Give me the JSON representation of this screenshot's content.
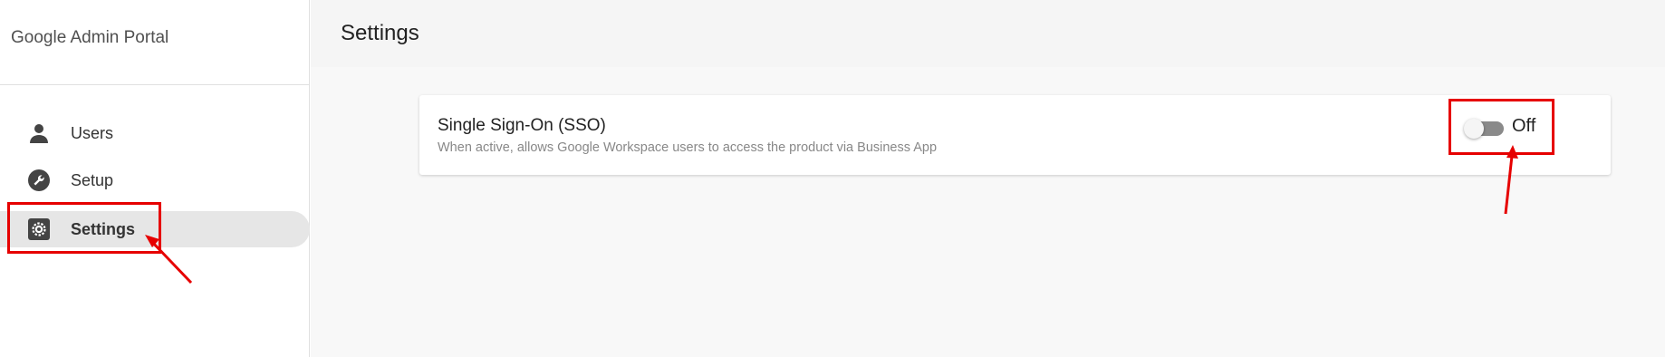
{
  "sidebar": {
    "brand": "Google Admin Portal",
    "items": [
      {
        "label": "Users",
        "icon": "person-icon"
      },
      {
        "label": "Setup",
        "icon": "wrench-icon"
      },
      {
        "label": "Settings",
        "icon": "gear-icon",
        "active": true
      }
    ]
  },
  "main": {
    "title": "Settings",
    "sso": {
      "title": "Single Sign-On (SSO)",
      "description": "When active, allows Google Workspace users to access the product via Business App",
      "toggle_state": "Off"
    }
  },
  "colors": {
    "annotation": "#e60000",
    "active_nav_bg": "#e6e6e6",
    "toggle_track": "#8a8a8a"
  }
}
